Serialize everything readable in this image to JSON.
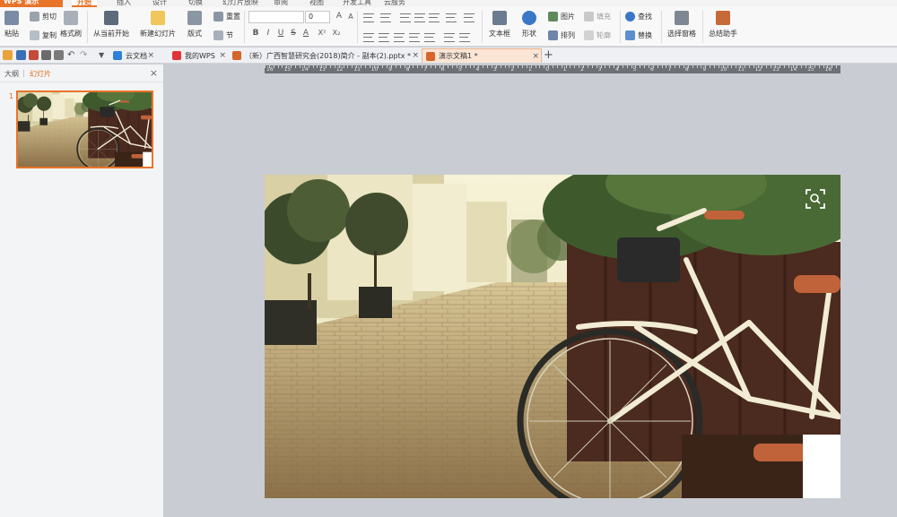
{
  "app": {
    "title": "WPS 演示",
    "menu_tabs": [
      "开始",
      "插入",
      "设计",
      "切换",
      "幻灯片放映",
      "审阅",
      "视图",
      "开发工具",
      "云服务"
    ],
    "active_menu": "开始"
  },
  "ribbon": {
    "paste": "粘贴",
    "cut": "剪切",
    "copy": "复制",
    "format_painter": "格式刷",
    "from_start": "从当前开始",
    "new_slide": "新建幻灯片",
    "layout": "版式",
    "section": "节",
    "reset": "重置",
    "font_size": "0",
    "bold": "B",
    "italic": "I",
    "underline": "U",
    "strike": "S",
    "font_color": "A",
    "superscript": "X²",
    "subscript": "X₂",
    "textbox": "文本框",
    "shape": "形状",
    "picture": "图片",
    "fill": "填充",
    "arrange": "排列",
    "outline": "轮廓",
    "find": "查找",
    "replace": "替换",
    "select_pane": "选择窗格",
    "summary_helper": "总结助手"
  },
  "tabs": {
    "items": [
      {
        "label": "云文档"
      },
      {
        "label": "我的WPS"
      },
      {
        "label": "（新）广西智慧研究会(2018)简介 - 副本(2).pptx *"
      },
      {
        "label": "演示文稿1 *"
      }
    ],
    "active_index": 3
  },
  "left_pane": {
    "tab_outline": "大纲",
    "tab_slides": "幻灯片",
    "slide_number": "1"
  },
  "ruler": {
    "labels": [
      "16",
      "15",
      "14",
      "13",
      "12",
      "11",
      "10",
      "9",
      "8",
      "7",
      "6",
      "5",
      "4",
      "3",
      "2",
      "1",
      "0",
      "1",
      "2",
      "3",
      "4",
      "5",
      "6",
      "7",
      "8",
      "9",
      "10",
      "11",
      "12",
      "13",
      "14",
      "15",
      "16"
    ]
  },
  "colors": {
    "accent": "#e8742a",
    "canvas": "#c9ccd2"
  }
}
